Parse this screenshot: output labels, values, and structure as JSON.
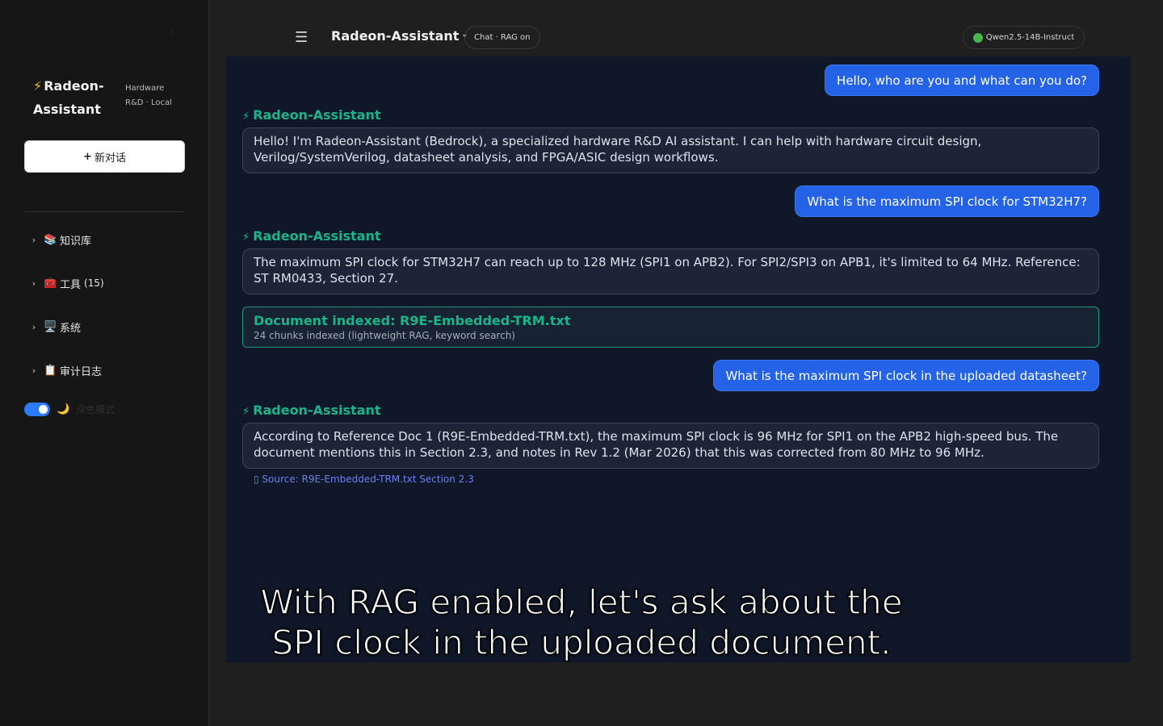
{
  "sidebar": {
    "collapse_icon": "chevron-left-icon",
    "brand": {
      "bolt": "⚡",
      "name": "Radeon-Assistant",
      "subtitle_line1": "Hardware",
      "subtitle_line2": "R&D · Local"
    },
    "new_chat": {
      "icon": "+",
      "label": "新对话"
    },
    "items": [
      {
        "icon": "📚",
        "label": "知识库",
        "count": ""
      },
      {
        "icon": "🧰",
        "label": "工具",
        "count": "(15)"
      },
      {
        "icon": "🖥️",
        "label": "系统",
        "count": ""
      },
      {
        "icon": "📋",
        "label": "审计日志",
        "count": ""
      }
    ],
    "theme_toggle": {
      "on": true,
      "icon": "🌙",
      "label": "深色模式"
    }
  },
  "topbar": {
    "menu_icon": "☰",
    "title": "Radeon-Assistant",
    "caret": "▾",
    "mode": "Chat · RAG on",
    "model": "Qwen2.5-14B-Instruct"
  },
  "chat": {
    "assistant_name": "Radeon-Assistant",
    "messages": [
      {
        "role": "user",
        "text": "Hello, who are you and what can you do?"
      },
      {
        "role": "assistant",
        "text": "Hello! I'm Radeon-Assistant (Bedrock), a specialized hardware R&D AI assistant. I can help with hardware circuit design, Verilog/SystemVerilog, datasheet analysis, and FPGA/ASIC design workflows."
      },
      {
        "role": "user",
        "text": "What is the maximum SPI clock for STM32H7?"
      },
      {
        "role": "assistant",
        "text": "The maximum SPI clock for STM32H7 can reach up to 128 MHz (SPI1 on APB2). For SPI2/SPI3 on APB1, it's limited to 64 MHz. Reference: ST RM0433, Section 27."
      },
      {
        "role": "user",
        "text": "What is the maximum SPI clock in the uploaded datasheet?"
      },
      {
        "role": "assistant",
        "text": "According to Reference Doc 1 (R9E-Embedded-TRM.txt), the maximum SPI clock is 96 MHz for SPI1 on the APB2 high-speed bus. The document mentions this in Section 2.3, and notes in Rev 1.2 (Mar 2026) that this was corrected from 80 MHz to 96 MHz."
      }
    ],
    "document_notice": {
      "title": "Document indexed: R9E-Embedded-TRM.txt",
      "detail": "24 chunks indexed (lightweight RAG, keyword search)"
    },
    "source": "▯ Source: R9E-Embedded-TRM.txt Section 2.3"
  },
  "caption": {
    "line1": "With RAG enabled, let's ask about the",
    "line2": "SPI clock in the uploaded document."
  },
  "colors": {
    "accent": "#2462e8",
    "assistant_name": "#19b58b",
    "chat_background": "#0f1729",
    "sidebar_background": "#161616",
    "status_online": "#46b54a"
  }
}
